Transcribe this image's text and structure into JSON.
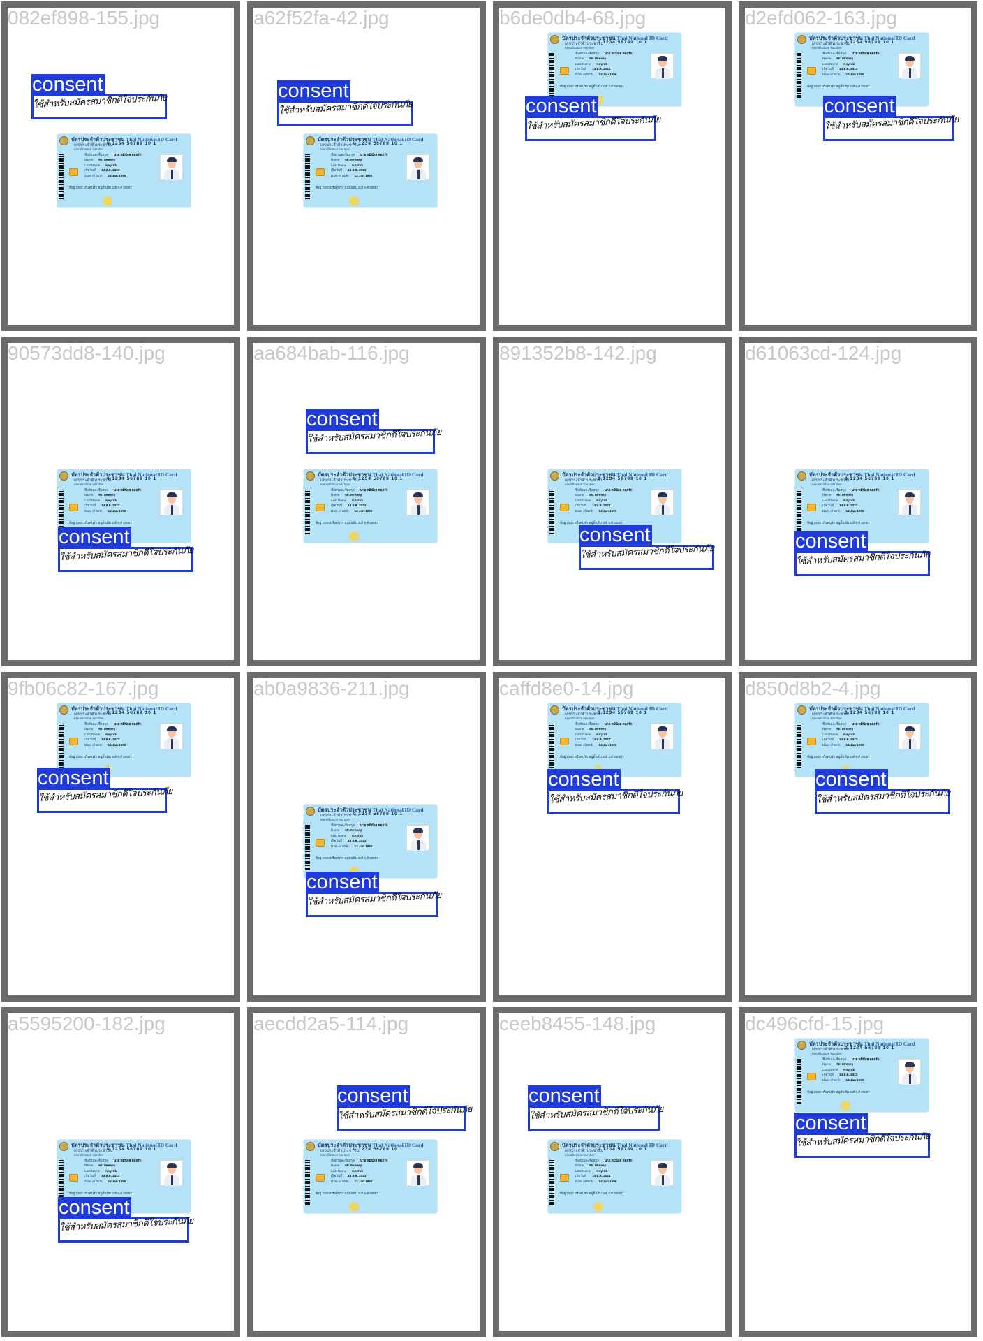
{
  "card": {
    "title_th": "บัตรประจำตัวประชาชน",
    "title_en": "Thai National ID Card",
    "number_label": "เลขประจำตัวประชาชน",
    "number": "0 1234 56789 10 1",
    "id_label": "Identification Number",
    "rows": [
      {
        "label": "ชื่อตัวและชื่อสกุล",
        "value": "นาย หมีน้อย คอยรัก"
      },
      {
        "label": "Name",
        "value": "Mr. Mreoey"
      },
      {
        "label": "Last Name",
        "value": "Koyruk"
      },
      {
        "label": "เกิดวันที่",
        "value": "14 ส.ค. 2023"
      },
      {
        "label": "Date of Birth",
        "value": "14 Jan 1990"
      }
    ],
    "address": "ที่อยู่ 2300 หรือคนรัก หมู่ดั้งเดิม อ.ดี จ.ดี 20007"
  },
  "consent_label": "consent",
  "consent_text": "ใช้สำหรับสมัครสมาชิกดีใจประกันภัย",
  "tiles": [
    {
      "filename": "082ef898-155.jpg"
    },
    {
      "filename": "a62f52fa-42.jpg"
    },
    {
      "filename": "b6de0db4-68.jpg"
    },
    {
      "filename": "d2efd062-163.jpg"
    },
    {
      "filename": "90573dd8-140.jpg"
    },
    {
      "filename": "aa684bab-116.jpg"
    },
    {
      "filename": "891352b8-142.jpg"
    },
    {
      "filename": "d61063cd-124.jpg"
    },
    {
      "filename": "9fb06c82-167.jpg"
    },
    {
      "filename": "ab0a9836-211.jpg"
    },
    {
      "filename": "caffd8e0-14.jpg"
    },
    {
      "filename": "d850d8b2-4.jpg"
    },
    {
      "filename": "a5595200-182.jpg"
    },
    {
      "filename": "aecdd2a5-114.jpg"
    },
    {
      "filename": "ceeb8455-148.jpg"
    },
    {
      "filename": "dc496cfd-15.jpg"
    }
  ]
}
